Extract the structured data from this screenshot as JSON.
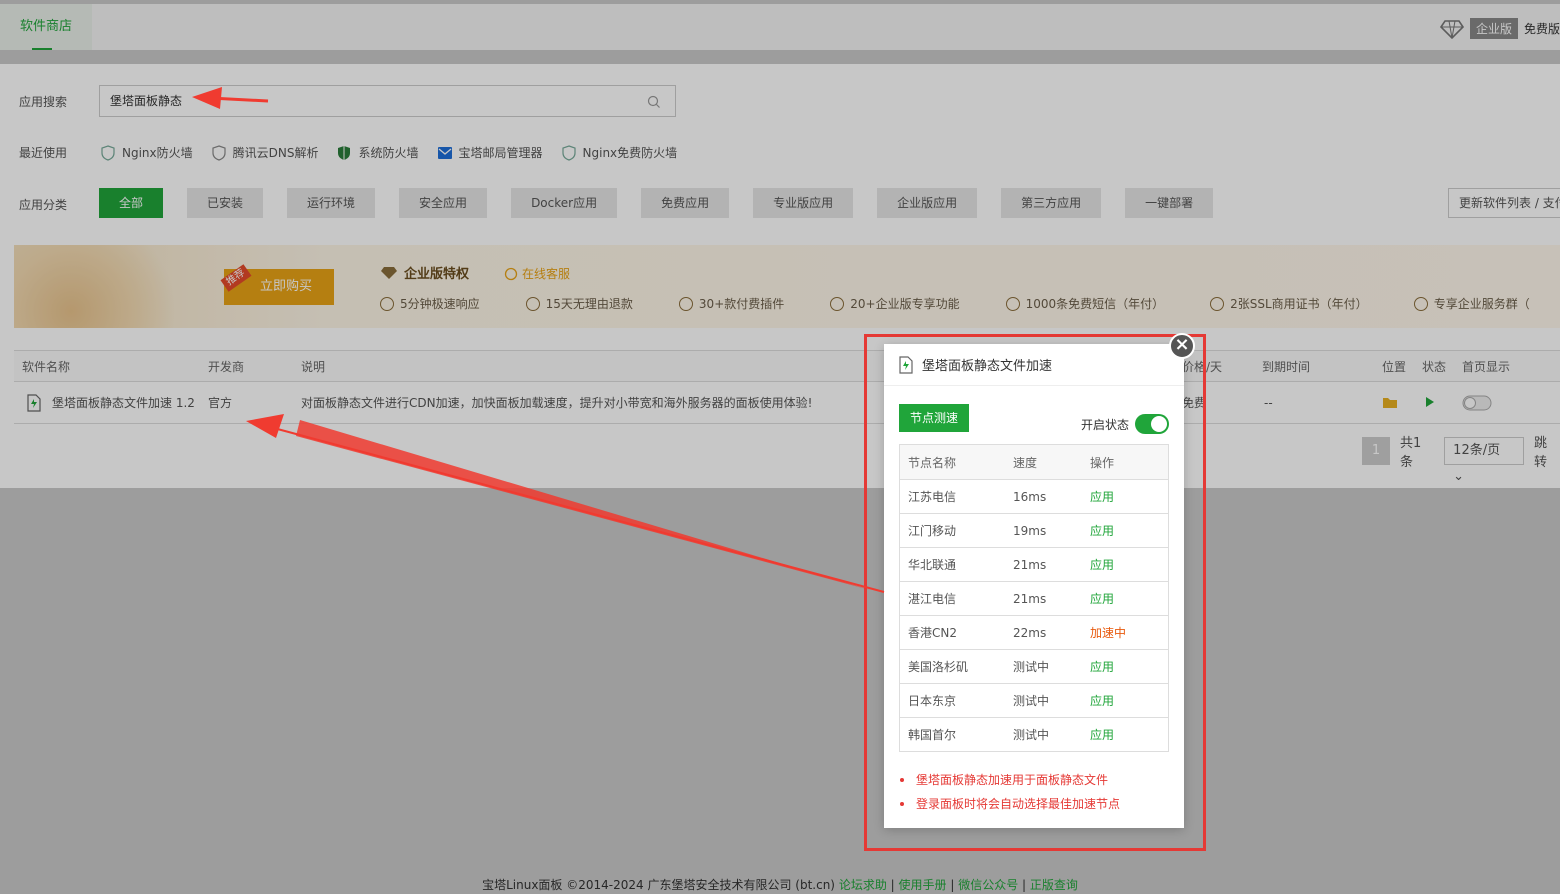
{
  "topbar": {
    "tab": "软件商店",
    "enterprise_badge": "企业版",
    "free_label": "免费版"
  },
  "search": {
    "label": "应用搜索",
    "value": "堡塔面板静态"
  },
  "recent": {
    "label": "最近使用",
    "items": [
      "Nginx防火墙",
      "腾讯云DNS解析",
      "系统防火墙",
      "宝塔邮局管理器",
      "Nginx免费防火墙"
    ]
  },
  "categories": {
    "label": "应用分类",
    "items": [
      "全部",
      "已安装",
      "运行环境",
      "安全应用",
      "Docker应用",
      "免费应用",
      "专业版应用",
      "企业版应用",
      "第三方应用",
      "一键部署"
    ],
    "update_button": "更新软件列表 / 支付"
  },
  "banner": {
    "tag": "推荐",
    "buy": "立即购买",
    "title": "企业版特权",
    "service": "在线客服",
    "perks": [
      "5分钟极速响应",
      "15天无理由退款",
      "30+款付费插件",
      "20+企业版专享功能",
      "1000条免费短信（年付）",
      "2张SSL商用证书（年付）",
      "专享企业服务群（"
    ]
  },
  "table": {
    "headers": {
      "name": "软件名称",
      "dev": "开发商",
      "desc": "说明",
      "price": "价格/天",
      "expire": "到期时间",
      "pos": "位置",
      "status": "状态",
      "home": "首页显示"
    },
    "row": {
      "name": "堡塔面板静态文件加速 1.2",
      "dev": "官方",
      "desc": "对面板静态文件进行CDN加速，加快面板加载速度，提升对小带宽和海外服务器的面板使用体验!",
      "price": "免费",
      "expire": "--"
    }
  },
  "pager": {
    "current": "1",
    "total": "共1条",
    "per_page": "12条/页",
    "jump": "跳转"
  },
  "modal": {
    "title": "堡塔面板静态文件加速",
    "node_test": "节点测速",
    "switch_label": "开启状态",
    "headers": [
      "节点名称",
      "速度",
      "操作"
    ],
    "nodes": [
      {
        "name": "江苏电信",
        "speed": "16ms",
        "action": "应用",
        "state": "ok"
      },
      {
        "name": "江门移动",
        "speed": "19ms",
        "action": "应用",
        "state": "ok"
      },
      {
        "name": "华北联通",
        "speed": "21ms",
        "action": "应用",
        "state": "ok"
      },
      {
        "name": "湛江电信",
        "speed": "21ms",
        "action": "应用",
        "state": "ok"
      },
      {
        "name": "香港CN2",
        "speed": "22ms",
        "action": "加速中",
        "state": "active"
      },
      {
        "name": "美国洛杉矶",
        "speed": "测试中",
        "action": "应用",
        "state": "ok"
      },
      {
        "name": "日本东京",
        "speed": "测试中",
        "action": "应用",
        "state": "ok"
      },
      {
        "name": "韩国首尔",
        "speed": "测试中",
        "action": "应用",
        "state": "ok"
      }
    ],
    "notes": [
      "堡塔面板静态加速用于面板静态文件",
      "登录面板时将会自动选择最佳加速节点"
    ]
  },
  "footer": {
    "copyright": "宝塔Linux面板 ©2014-2024 广东堡塔安全技术有限公司 (bt.cn)",
    "links": [
      "论坛求助",
      "使用手册",
      "微信公众号",
      "正版查询"
    ]
  },
  "colors": {
    "accent": "#20a53a",
    "warning": "#e8590c",
    "highlight": "#e53935"
  }
}
